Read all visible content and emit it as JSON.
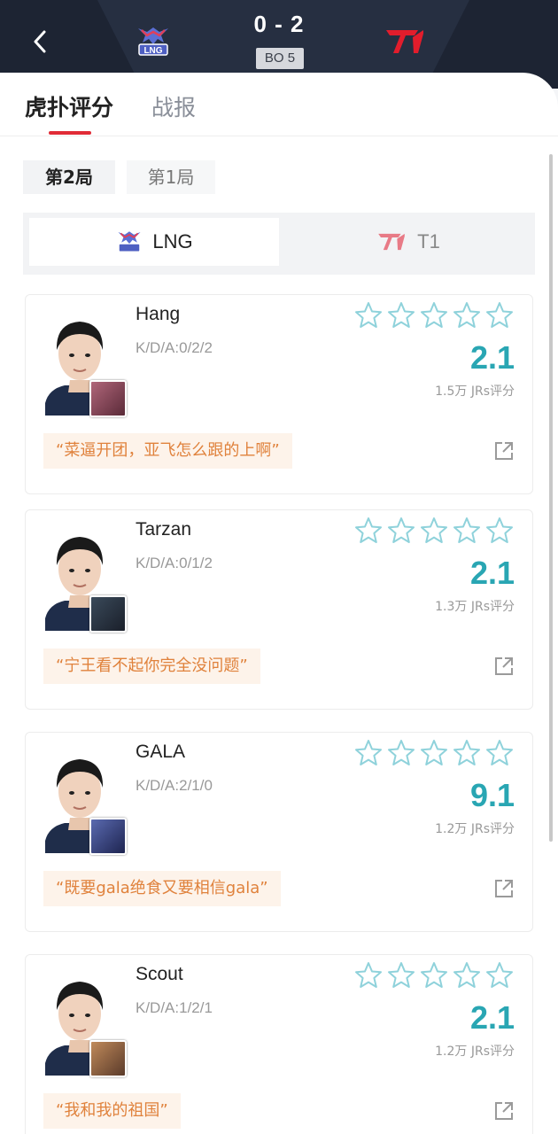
{
  "header": {
    "score": "0 - 2",
    "series": "BO 5",
    "left_team_logo": "LNG",
    "right_team_logo": "T1",
    "back_icon": "chevron-left-icon"
  },
  "tabs": [
    {
      "label": "虎扑评分",
      "active": true
    },
    {
      "label": "战报",
      "active": false
    }
  ],
  "games": [
    {
      "label": "第2局",
      "active": true
    },
    {
      "label": "第1局",
      "active": false
    }
  ],
  "teams": [
    {
      "label": "LNG",
      "active": true
    },
    {
      "label": "T1",
      "active": false
    }
  ],
  "players": [
    {
      "name": "Hang",
      "kda": "K/D/A:0/2/2",
      "rating": "2.1",
      "votes": "1.5万 JRs评分",
      "comment": "“菜逼开团，亚飞怎么跟的上啊”",
      "stars_filled": 0
    },
    {
      "name": "Tarzan",
      "kda": "K/D/A:0/1/2",
      "rating": "2.1",
      "votes": "1.3万 JRs评分",
      "comment": "“宁王看不起你完全没问题”",
      "stars_filled": 0
    },
    {
      "name": "GALA",
      "kda": "K/D/A:2/1/0",
      "rating": "9.1",
      "votes": "1.2万 JRs评分",
      "comment": "“既要gala绝食又要相信gala”",
      "stars_filled": 0
    },
    {
      "name": "Scout",
      "kda": "K/D/A:1/2/1",
      "rating": "2.1",
      "votes": "1.2万 JRs评分",
      "comment": "“我和我的祖国”",
      "stars_filled": 0
    }
  ],
  "colors": {
    "header_bg": "#1d2433",
    "accent_red": "#e02b36",
    "rating_teal": "#29a6b3",
    "star_outline": "#8fd2db",
    "comment_text": "#e0823c",
    "comment_bg": "#fdf3ea"
  }
}
